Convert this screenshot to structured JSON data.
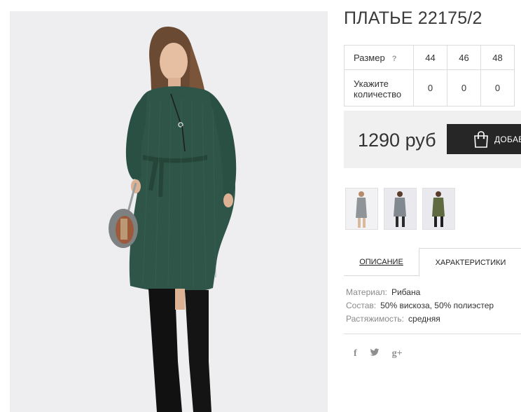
{
  "product": {
    "title": "ПЛАТЬЕ 22175/2"
  },
  "size_table": {
    "size_label": "Размер",
    "help_icon": "?",
    "sizes": [
      "44",
      "46",
      "48"
    ],
    "qty_label": "Укажите количество",
    "quantities": [
      "0",
      "0",
      "0"
    ]
  },
  "purchase": {
    "price": "1290 руб",
    "cart_label": "ДОБАВИТЬ",
    "cart_icon": "shopping-bag-icon"
  },
  "tabs": {
    "description": "ОПИСАНИЕ",
    "characteristics": "ХАРАКТЕРИСТИКИ",
    "active": "characteristics"
  },
  "specs": [
    {
      "key": "Материал:",
      "value": "Рибана"
    },
    {
      "key": "Состав:",
      "value": "50% вискоза, 50% полиэстер"
    },
    {
      "key": "Растяжимость:",
      "value": "средняя"
    }
  ],
  "social": {
    "facebook": "f",
    "twitter": "🐦",
    "googleplus": "g+"
  },
  "colors": {
    "dress_main": "#2e5548",
    "dress_gray": "#8e9497",
    "dress_olive": "#5f6a40",
    "dark_button": "#262626",
    "price_bg": "#f0f0f0"
  }
}
